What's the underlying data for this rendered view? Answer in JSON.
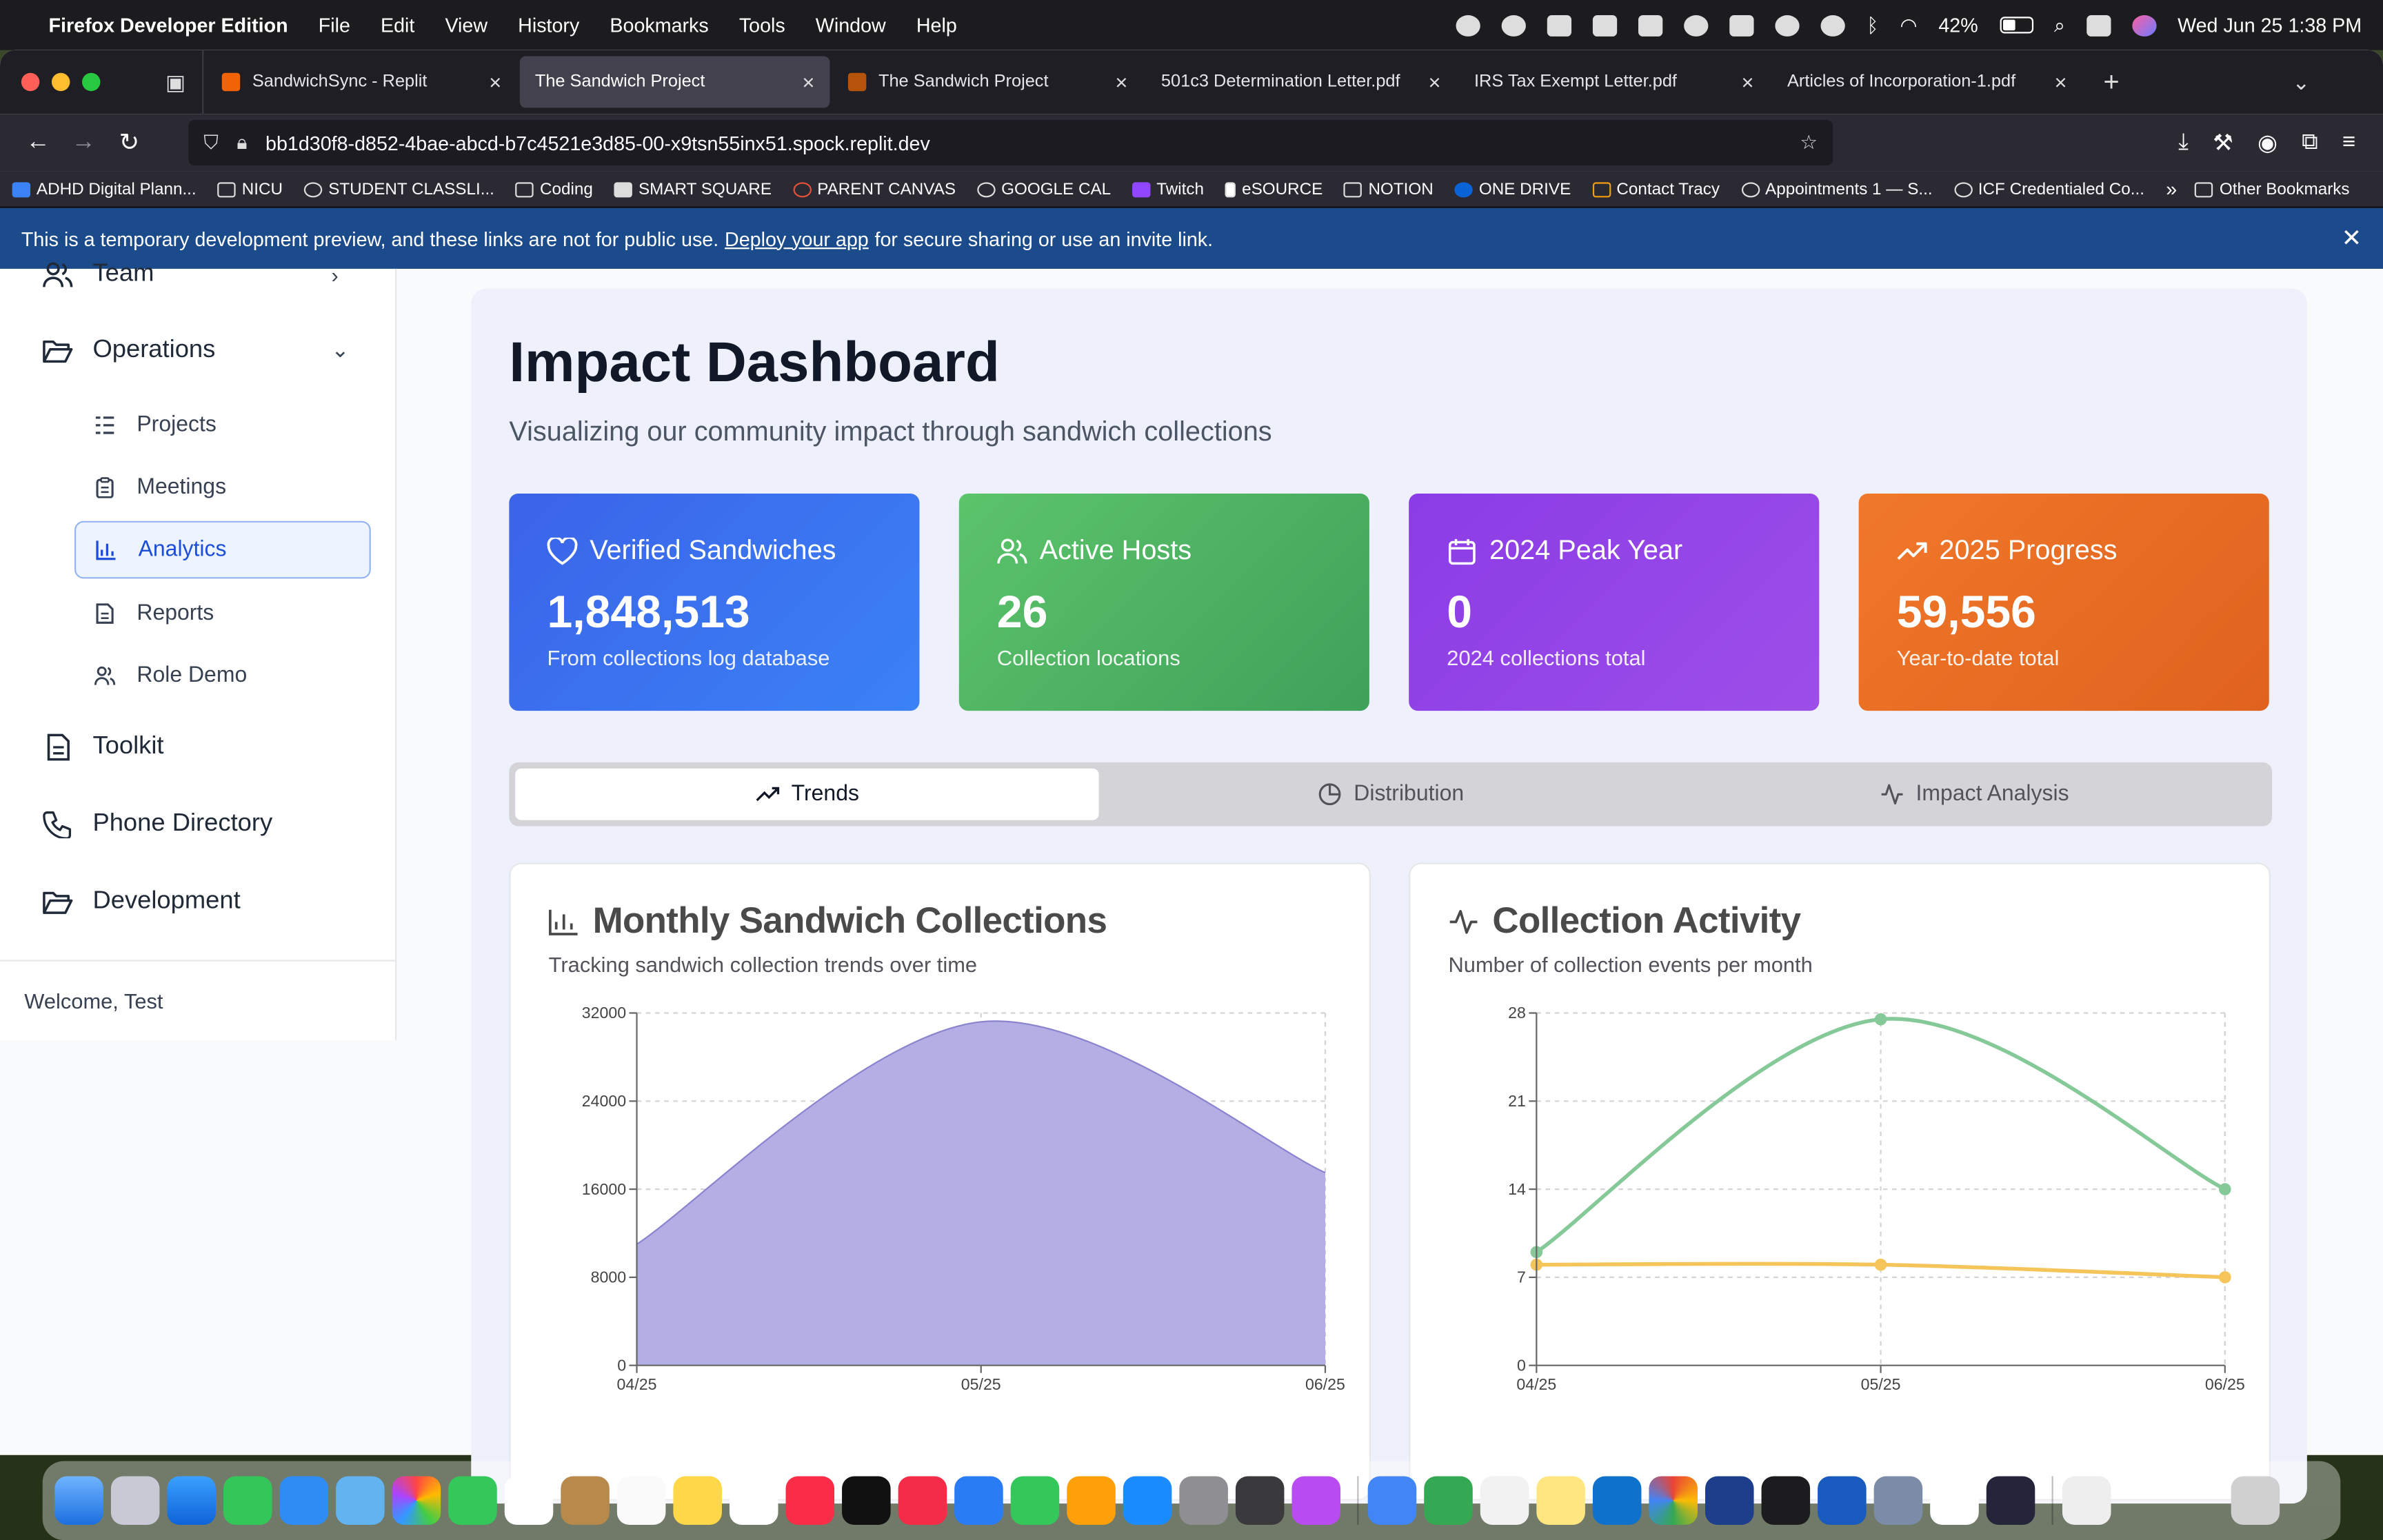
{
  "menubar": {
    "app_name": "Firefox Developer Edition",
    "menus": [
      "File",
      "Edit",
      "View",
      "History",
      "Bookmarks",
      "Tools",
      "Window",
      "Help"
    ],
    "battery_percent": "42%",
    "datetime": "Wed Jun 25  1:38 PM"
  },
  "browser": {
    "tabs": [
      {
        "label": "SandwichSync - Replit",
        "favicon_color": "#f26207"
      },
      {
        "label": "The Sandwich Project",
        "favicon_color": "#f59e0b"
      },
      {
        "label": "The Sandwich Project",
        "favicon_color": "#b45309"
      },
      {
        "label": "501c3 Determination Letter.pdf",
        "favicon_color": ""
      },
      {
        "label": "IRS Tax Exempt Letter.pdf",
        "favicon_color": ""
      },
      {
        "label": "Articles of Incorporation-1.pdf",
        "favicon_color": ""
      }
    ],
    "url": "bb1d30f8-d852-4bae-abcd-b7c4521e3d85-00-x9tsn55inx51.spock.replit.dev",
    "bookmarks": [
      "ADHD Digital Plann...",
      "NICU",
      "STUDENT CLASSLI...",
      "Coding",
      "SMART SQUARE",
      "PARENT CANVAS",
      "GOOGLE CAL",
      "Twitch",
      "eSOURCE",
      "NOTION",
      "ONE DRIVE",
      "Contact Tracy",
      "Appointments 1 — S...",
      "ICF Credentialed Co..."
    ],
    "other_bookmarks": "Other Bookmarks"
  },
  "banner": {
    "text_before": "This is a temporary development preview, and these links are not for public use.",
    "link": "Deploy your app",
    "text_after": "for secure sharing or use an invite link."
  },
  "sidebar": {
    "team": "Team",
    "operations": "Operations",
    "sub_items": [
      "Projects",
      "Meetings",
      "Analytics",
      "Reports",
      "Role Demo"
    ],
    "toolkit": "Toolkit",
    "phone_directory": "Phone Directory",
    "development": "Development",
    "welcome": "Welcome, Test"
  },
  "dashboard": {
    "title": "Impact Dashboard",
    "subtitle": "Visualizing our community impact through sandwich collections",
    "stats": [
      {
        "title": "Verified Sandwiches",
        "value": "1,848,513",
        "desc": "From collections log database",
        "color_from": "#3b63e8",
        "color_to": "#3b82f6"
      },
      {
        "title": "Active Hosts",
        "value": "26",
        "desc": "Collection locations",
        "color_from": "#5cc46b",
        "color_to": "#3fa15a"
      },
      {
        "title": "2024 Peak Year",
        "value": "0",
        "desc": "2024 collections total",
        "color_from": "#8b3ce6",
        "color_to": "#9d4ee8"
      },
      {
        "title": "2025 Progress",
        "value": "59,556",
        "desc": "Year-to-date total",
        "color_from": "#f0782a",
        "color_to": "#e0621e"
      }
    ],
    "tabs": [
      "Trends",
      "Distribution",
      "Impact Analysis"
    ],
    "cards": [
      {
        "title": "Monthly Sandwich Collections",
        "subtitle": "Tracking sandwich collection trends over time"
      },
      {
        "title": "Collection Activity",
        "subtitle": "Number of collection events per month"
      }
    ]
  },
  "chart_data": [
    {
      "type": "area",
      "title": "Monthly Sandwich Collections",
      "categories": [
        "04/25",
        "05/25",
        "06/25"
      ],
      "series": [
        {
          "values": [
            11000,
            31200,
            17500
          ],
          "color": "#b3aee3"
        }
      ],
      "ylim": [
        0,
        32000
      ],
      "yticks": [
        0,
        8000,
        16000,
        24000,
        32000
      ],
      "grid": true
    },
    {
      "type": "line",
      "title": "Collection Activity",
      "categories": [
        "04/25",
        "05/25",
        "06/25"
      ],
      "series": [
        {
          "values": [
            9,
            27.5,
            14
          ],
          "color": "#86c998"
        },
        {
          "values": [
            8,
            8,
            7
          ],
          "color": "#f5c55a"
        }
      ],
      "ylim": [
        0,
        28
      ],
      "yticks": [
        0,
        7,
        14,
        21,
        28
      ],
      "grid": true
    }
  ]
}
